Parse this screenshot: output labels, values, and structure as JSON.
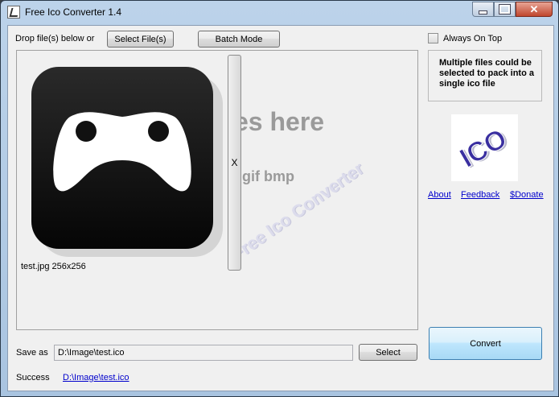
{
  "window": {
    "title": "Free Ico Converter 1.4",
    "close_glyph": "✕"
  },
  "toolbar": {
    "drop_label": "Drop file(s) below or",
    "select_files_label": "Select File(s)",
    "batch_mode_label": "Batch Mode"
  },
  "drop_area": {
    "hint_main": "es here",
    "hint_formats": "gif bmp",
    "watermark": "Free Ico Converter",
    "preview_caption": "test.jpg  256x256",
    "remove_label": "X"
  },
  "side": {
    "always_on_top_label": "Always On Top",
    "always_on_top_checked": false,
    "info_text": "Multiple files could be selected to pack into a single ico file",
    "logo_text": "ICO",
    "links": {
      "about": "About",
      "feedback": "Feedback",
      "donate": "$Donate"
    },
    "convert_label": "Convert"
  },
  "footer": {
    "save_as_label": "Save as",
    "save_path": "D:\\Image\\test.ico",
    "select_label": "Select",
    "status_label": "Success",
    "result_link": "D:\\Image\\test.ico"
  },
  "colors": {
    "link": "#0000cc",
    "watermark": "#dcdcec",
    "hint": "#9a9a9a"
  }
}
